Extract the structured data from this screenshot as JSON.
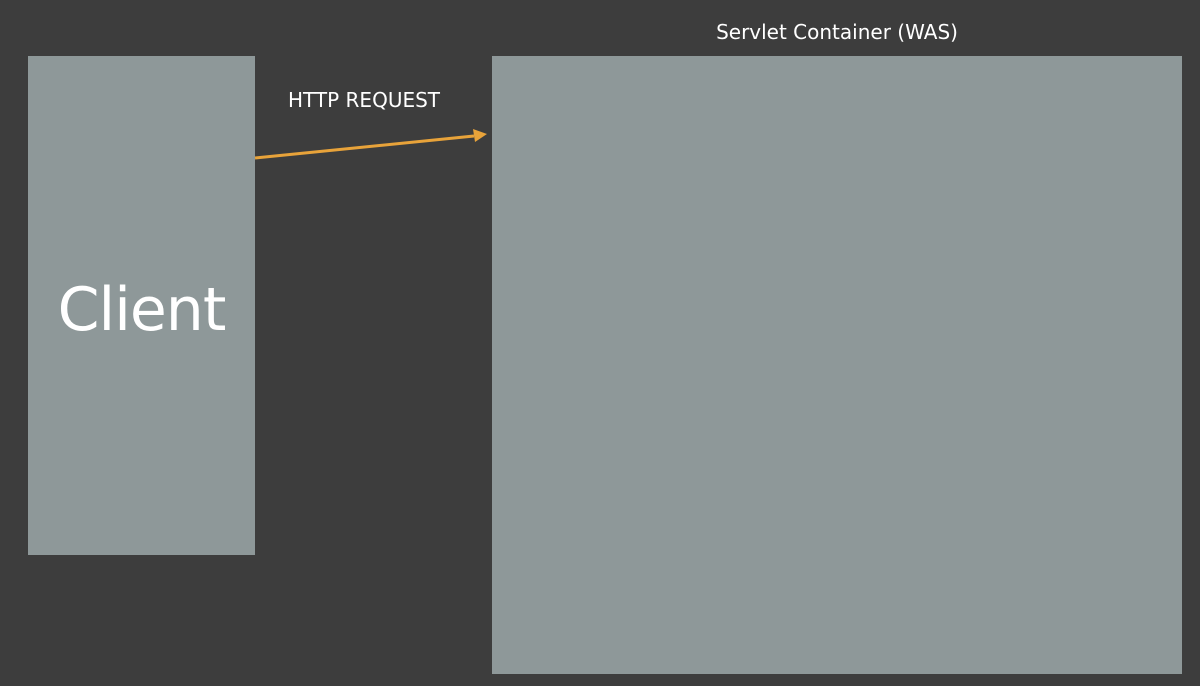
{
  "client": {
    "label": "Client"
  },
  "container": {
    "title": "Servlet Container (WAS)"
  },
  "request": {
    "label": "HTTP REQUEST"
  },
  "colors": {
    "background": "#3d3d3d",
    "box_fill": "#8e9899",
    "arrow": "#e8a33a",
    "text": "#ffffff"
  }
}
